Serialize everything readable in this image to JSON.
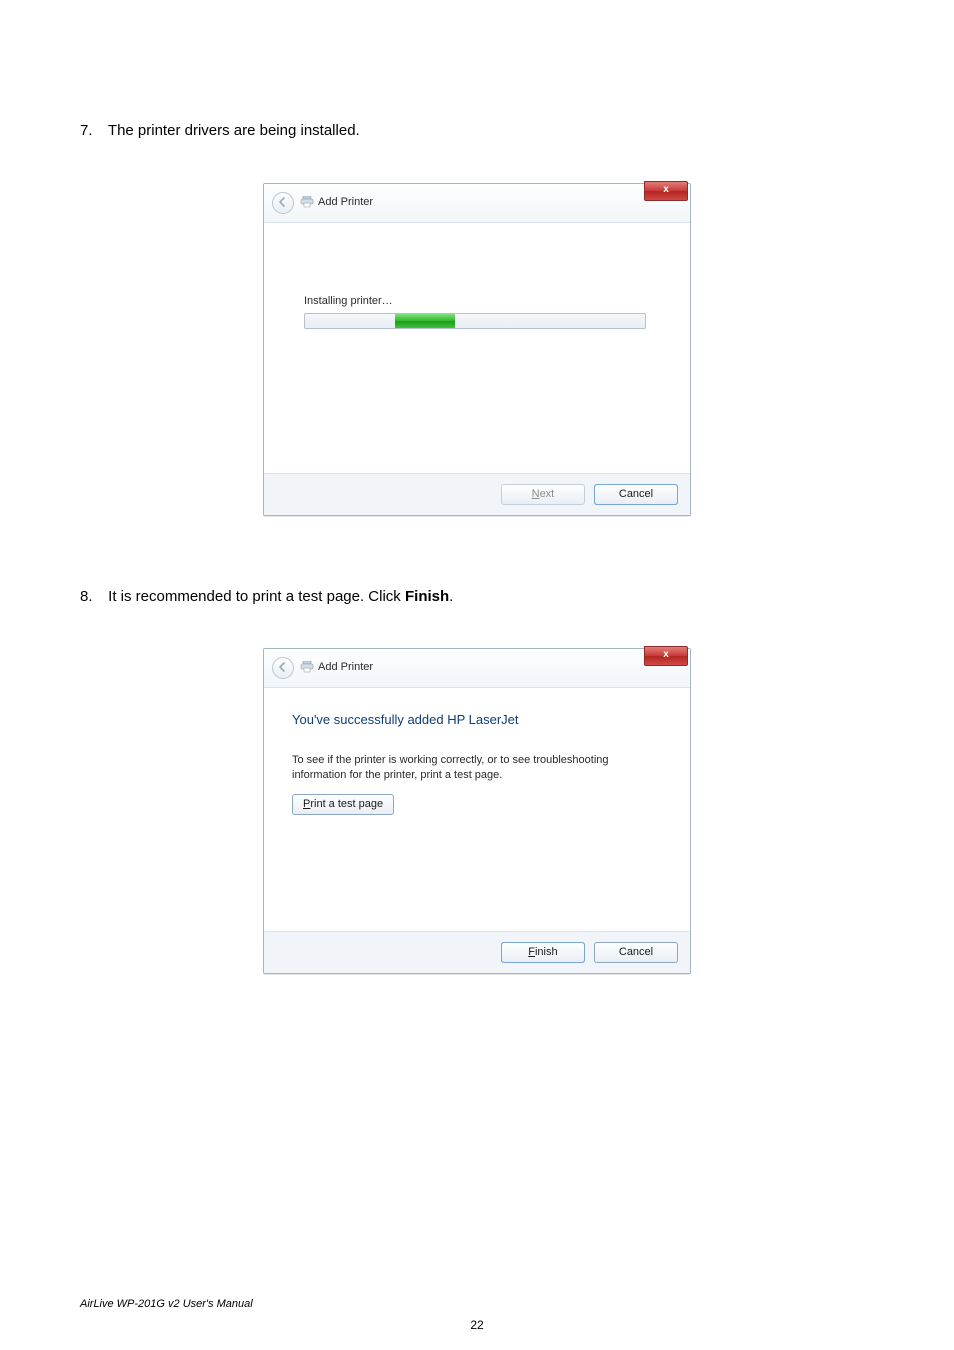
{
  "steps": {
    "s7": {
      "num": "7.",
      "text": "The printer drivers are being installed."
    },
    "s8": {
      "num": "8.",
      "text_pre": "It is recommended to print a test page. Click ",
      "bold": "Finish",
      "text_post": "."
    }
  },
  "dlg1": {
    "title": "Add Printer",
    "close_glyph": "x",
    "installing": "Installing printer…",
    "next_label": "Next",
    "cancel_label": "Cancel"
  },
  "dlg2": {
    "title": "Add Printer",
    "close_glyph": "x",
    "heading": "You've successfully added HP LaserJet",
    "help": "To see if the printer is working correctly, or to see troubleshooting information for the printer, print a test page.",
    "test_btn": "Print a test page",
    "finish_label": "Finish",
    "cancel_label": "Cancel"
  },
  "footer": "AirLive WP-201G v2 User's Manual",
  "page_number": "22"
}
